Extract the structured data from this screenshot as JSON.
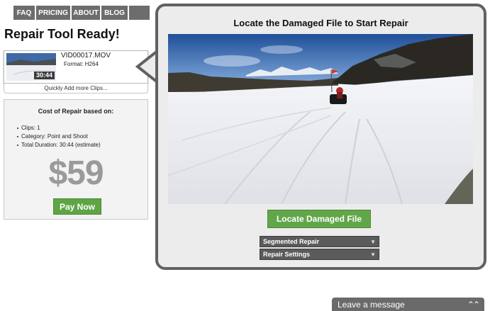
{
  "nav": {
    "items": [
      "FAQ",
      "PRICING",
      "ABOUT",
      "BLOG"
    ]
  },
  "status_title": "Repair Tool Ready!",
  "clip": {
    "filename": "VID00017.MOV",
    "format": "Format:  H264",
    "duration": "30:44"
  },
  "quick_add_label": "Quickly Add more Clips...",
  "cost": {
    "title": "Cost of Repair based on:",
    "items": [
      "Clips: 1",
      "Category: Point and Shoot",
      "Total Duration: 30:44 (estimate)"
    ],
    "price": "$59",
    "pay_label": "Pay Now"
  },
  "panel": {
    "title": "Locate the Damaged File to Start Repair",
    "locate_label": "Locate Damaged File",
    "dropdowns": [
      "Segmented Repair",
      "Repair Settings"
    ]
  },
  "chat": {
    "label": "Leave a message",
    "icon": "double-chevron-up-icon"
  },
  "colors": {
    "accent_green": "#62a64a",
    "dark_gray": "#616161",
    "price_gray": "#9a9a9a"
  }
}
